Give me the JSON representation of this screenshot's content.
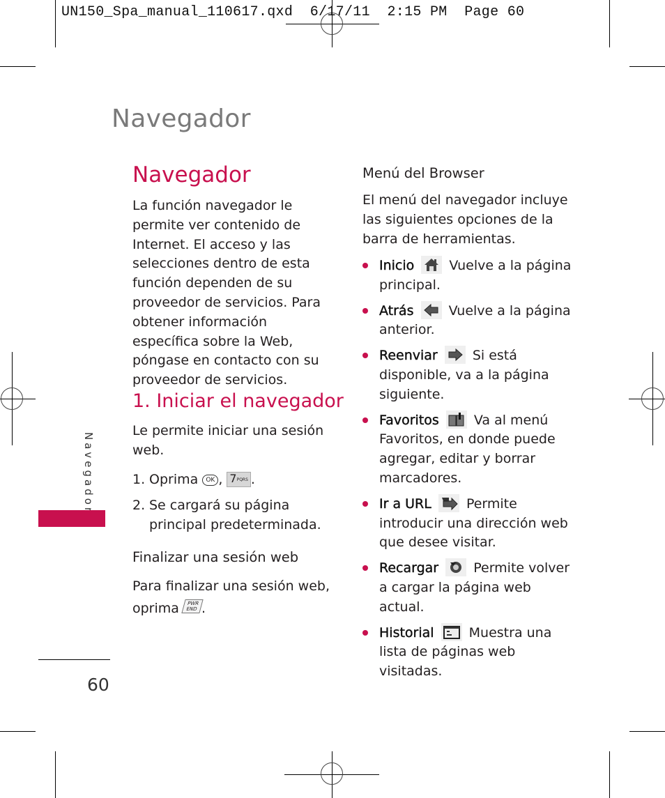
{
  "slug": "UN150_Spa_manual_110617.qxd  6/17/11  2:15 PM  Page 60",
  "running_head": "Navegador",
  "side_tab_label": "Navegador",
  "page_number": "60",
  "accent_color": "#c8104e",
  "left_column": {
    "title": "Navegador",
    "intro": "La función navegador le permite ver contenido de Internet. El acceso y las selecciones dentro de esta función dependen de su proveedor de servicios. Para obtener información específica sobre la Web, póngase en contacto con su proveedor de servicios.",
    "section_title": "1. Iniciar el navegador",
    "section_intro": "Le permite iniciar una sesión web.",
    "steps": [
      {
        "num": "1.",
        "text_before": "Oprima",
        "key1": "OK",
        "sep": ",",
        "key2_digit": "7",
        "key2_letters": "PQRS",
        "end": "."
      },
      {
        "num": "2.",
        "text": "Se cargará su página principal predeterminada."
      }
    ],
    "end_session": {
      "heading": "Finalizar una sesión web",
      "text_line1": "Para finalizar una sesión web,",
      "text_line2": "oprima",
      "key_top": "PWR",
      "key_bottom": "END",
      "end": "."
    }
  },
  "right_column": {
    "heading": "Menú del Browser",
    "intro": "El menú del navegador incluye las siguientes opciones de la barra de herramientas.",
    "items": [
      {
        "term": "Inicio",
        "icon": "home-icon",
        "desc": "Vuelve a la página principal."
      },
      {
        "term": "Atrás",
        "icon": "back-arrow-icon",
        "desc": "Vuelve a la página anterior."
      },
      {
        "term": "Reenviar",
        "icon": "forward-arrow-icon",
        "desc": "Si está disponible, va a la página siguiente."
      },
      {
        "term": "Favoritos",
        "icon": "bookmarks-icon",
        "desc": "Va al menú Favoritos, en donde puede agregar, editar y borrar marcadores."
      },
      {
        "term": "Ir a URL",
        "icon": "go-to-url-icon",
        "desc": "Permite introducir una dirección web que desee visitar."
      },
      {
        "term": "Recargar",
        "icon": "reload-icon",
        "desc": "Permite volver a cargar la página web actual."
      },
      {
        "term": "Historial",
        "icon": "history-icon",
        "desc": "Muestra una lista de páginas web visitadas."
      }
    ]
  }
}
